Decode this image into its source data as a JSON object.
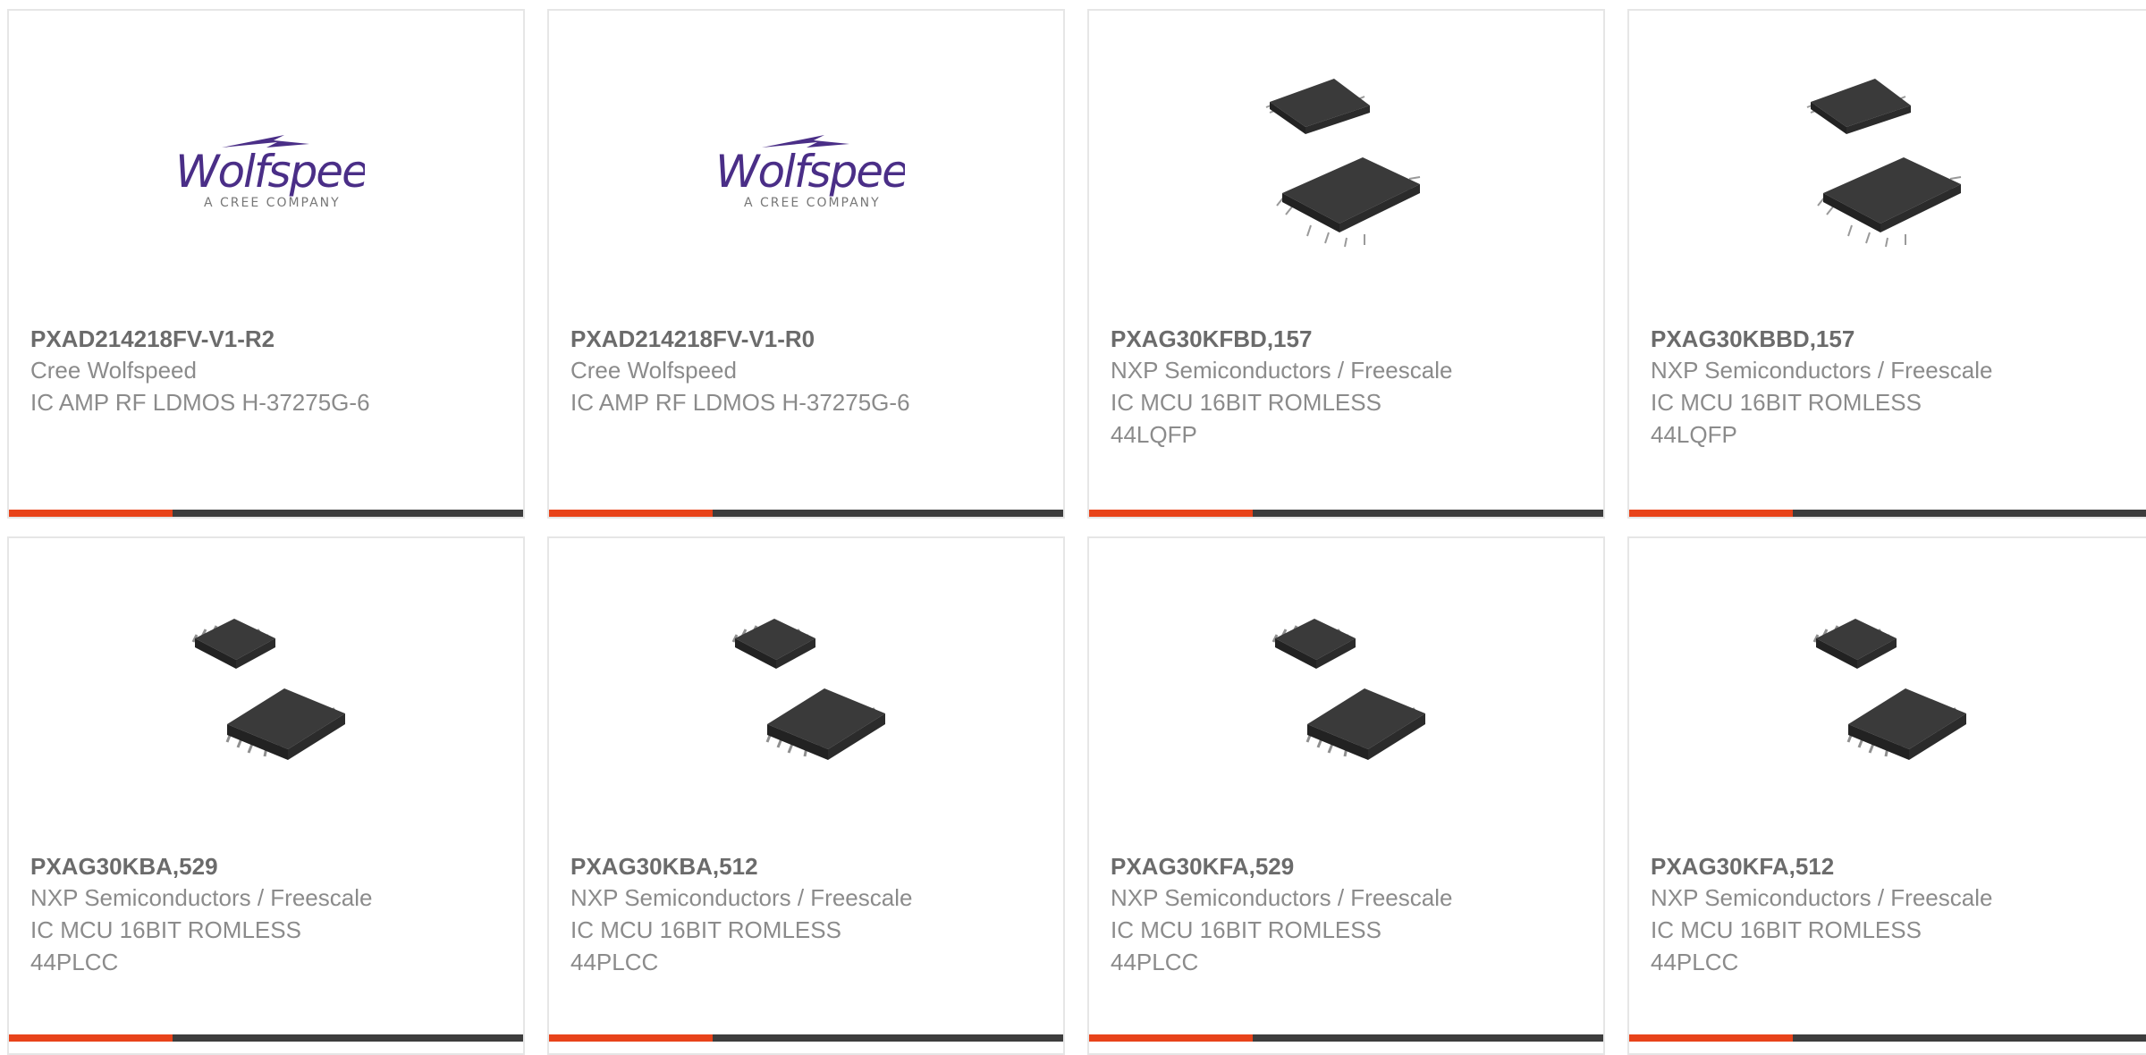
{
  "accent_color": "#e8431a",
  "cards": [
    {
      "part": "PXAD214218FV-V1-R2",
      "brand": "Cree Wolfspeed",
      "desc1": "IC AMP RF LDMOS H-37275G-6",
      "desc2": "",
      "image": "wolfspeed-logo",
      "logo": {
        "name": "Wolfspeed.",
        "tag": "A CREE COMPANY"
      }
    },
    {
      "part": "PXAD214218FV-V1-R0",
      "brand": "Cree Wolfspeed",
      "desc1": "IC AMP RF LDMOS H-37275G-6",
      "desc2": "",
      "image": "wolfspeed-logo",
      "logo": {
        "name": "Wolfspeed.",
        "tag": "A CREE COMPANY"
      }
    },
    {
      "part": "PXAG30KFBD,157",
      "brand": "NXP Semiconductors / Freescale",
      "desc1": "IC MCU 16BIT ROMLESS",
      "desc2": "44LQFP",
      "image": "lqfp-chip-icon"
    },
    {
      "part": "PXAG30KBBD,157",
      "brand": "NXP Semiconductors / Freescale",
      "desc1": "IC MCU 16BIT ROMLESS",
      "desc2": "44LQFP",
      "image": "lqfp-chip-icon"
    },
    {
      "part": "PXAG30KBA,529",
      "brand": "NXP Semiconductors / Freescale",
      "desc1": "IC MCU 16BIT ROMLESS",
      "desc2": "44PLCC",
      "image": "plcc-chip-icon"
    },
    {
      "part": "PXAG30KBA,512",
      "brand": "NXP Semiconductors / Freescale",
      "desc1": "IC MCU 16BIT ROMLESS",
      "desc2": "44PLCC",
      "image": "plcc-chip-icon"
    },
    {
      "part": "PXAG30KFA,529",
      "brand": "NXP Semiconductors / Freescale",
      "desc1": "IC MCU 16BIT ROMLESS",
      "desc2": "44PLCC",
      "image": "plcc-chip-icon"
    },
    {
      "part": "PXAG30KFA,512",
      "brand": "NXP Semiconductors / Freescale",
      "desc1": "IC MCU 16BIT ROMLESS",
      "desc2": "44PLCC",
      "image": "plcc-chip-icon"
    }
  ]
}
